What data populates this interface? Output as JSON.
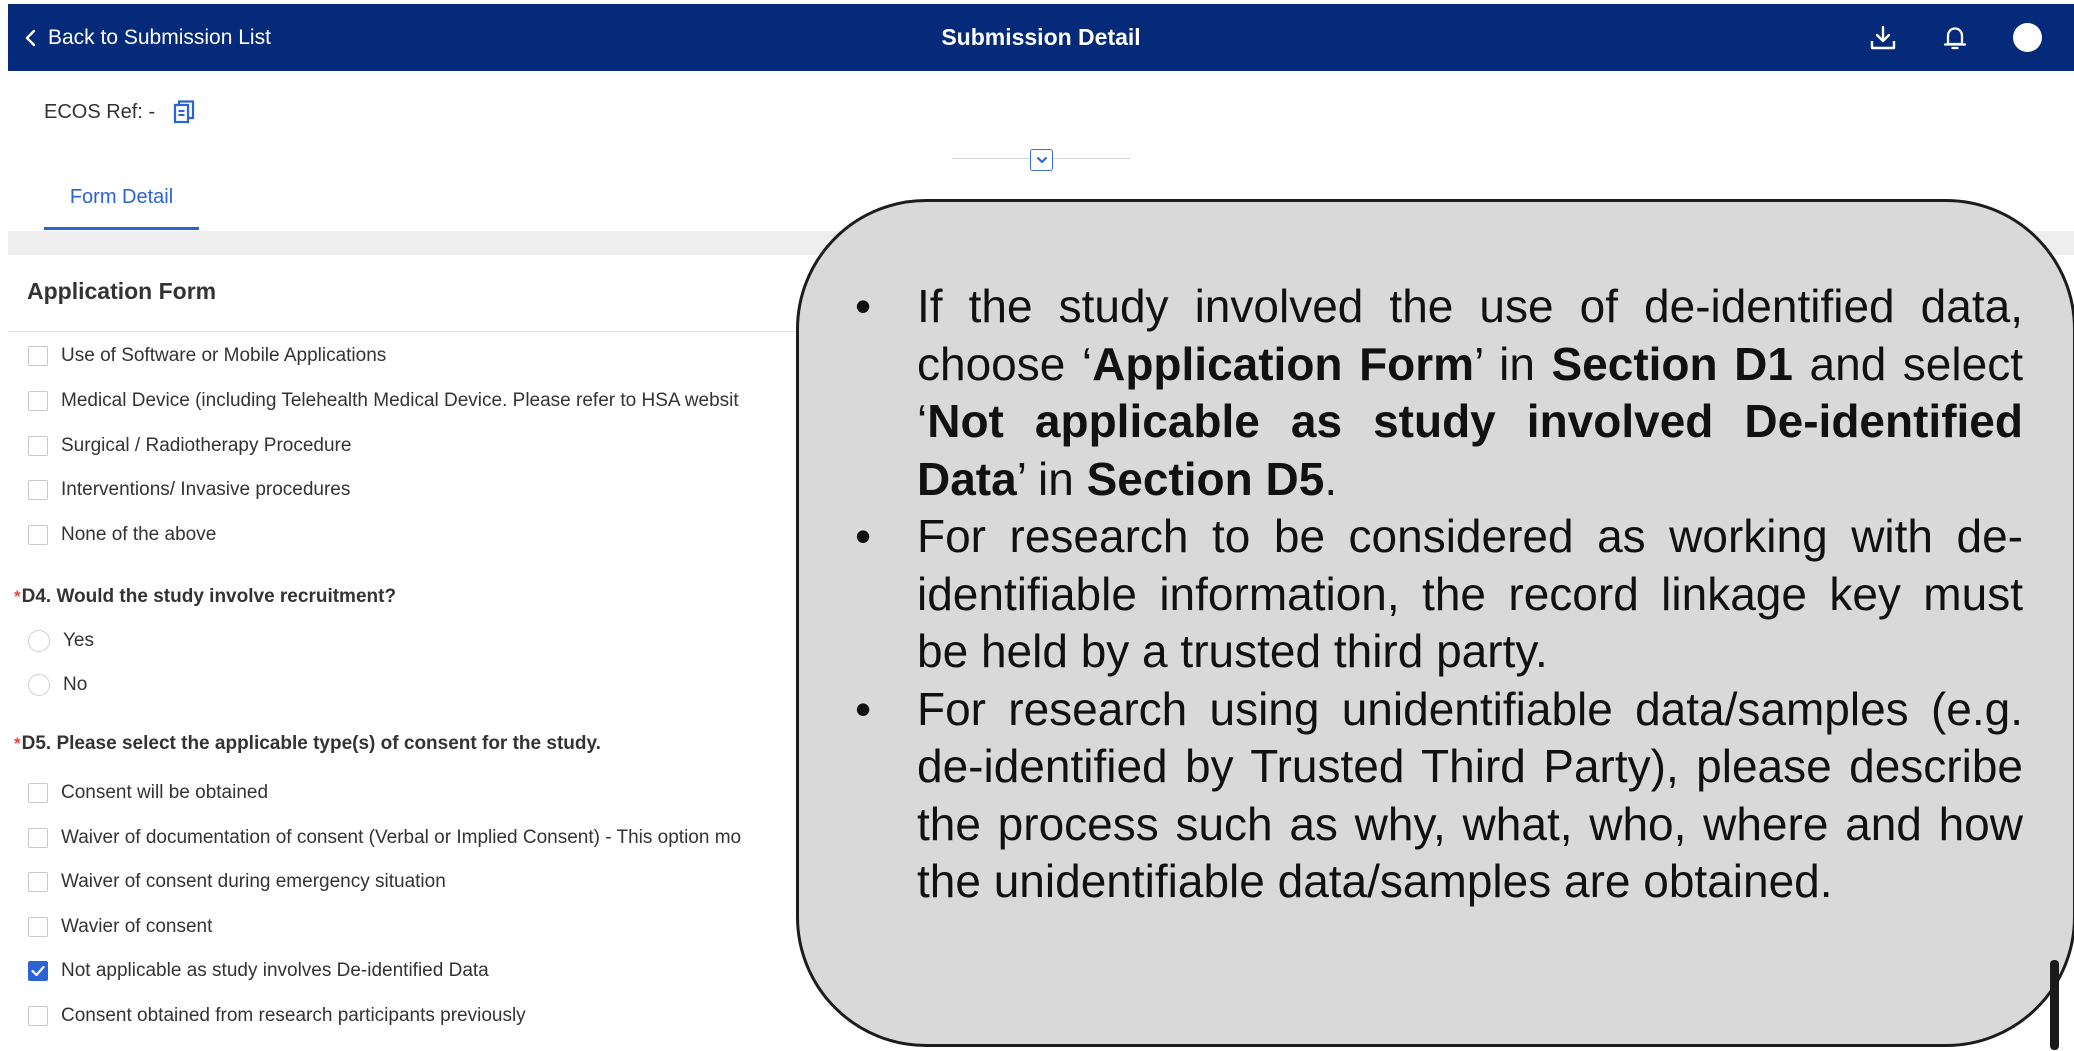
{
  "header": {
    "back_label": "Back to Submission List",
    "title": "Submission Detail",
    "background": "#052a7a"
  },
  "ecos": {
    "label": "ECOS Ref: -"
  },
  "tabs": [
    {
      "label": "Form Detail",
      "active": true
    }
  ],
  "form": {
    "section_title": "Application Form",
    "d3_options": [
      {
        "label": "Use of Software or Mobile Applications",
        "checked": false
      },
      {
        "label": "Medical Device (including Telehealth Medical Device. Please refer to HSA websit",
        "checked": false
      },
      {
        "label": "Surgical / Radiotherapy Procedure",
        "checked": false
      },
      {
        "label": "Interventions/ Invasive procedures",
        "checked": false
      },
      {
        "label": "None of the above",
        "checked": false
      }
    ],
    "d4": {
      "required_mark": "*",
      "question": "D4. Would the study involve recruitment?",
      "options": [
        {
          "label": "Yes"
        },
        {
          "label": "No"
        }
      ]
    },
    "d5": {
      "required_mark": "*",
      "question": "D5. Please select the applicable type(s) of consent for the study.",
      "options": [
        {
          "label": "Consent will be obtained",
          "checked": false
        },
        {
          "label": "Waiver of documentation of consent (Verbal or Implied Consent) - This option mo",
          "checked": false
        },
        {
          "label": "Waiver of consent during emergency situation",
          "checked": false
        },
        {
          "label": "Wavier of consent",
          "checked": false
        },
        {
          "label": "Not applicable as study involves De-identified Data",
          "checked": true
        },
        {
          "label": "Consent obtained from research participants previously",
          "checked": false
        }
      ]
    }
  },
  "callout": {
    "bullet": "•",
    "b1": {
      "t1": "If the study involved the use of de-identified data, choose ‘",
      "b1": "Application Form",
      "t2": "’ in ",
      "b2": "Section D1",
      "t3": " and select ‘",
      "b3": "Not applicable as study involved De-identified Data",
      "t4": "’ in ",
      "b4": "Section D5",
      "t5": "."
    },
    "b2": "For research to be considered as working with de-identifiable information, the record linkage key must be held by a trusted third party.",
    "b3": "For research using unidentifiable data/samples (e.g. de-identified by Trusted Third Party), please describe the process such as why, what, who, where and how the unidentifiable data/samples are obtained."
  },
  "colors": {
    "accent": "#2b63d4",
    "required": "#e04848",
    "callout_bg": "#d9d9d9"
  },
  "icons": [
    "chevron-left-icon",
    "download-icon",
    "bell-icon",
    "avatar",
    "copy-icon",
    "chevron-down-icon",
    "checkmark-icon"
  ]
}
